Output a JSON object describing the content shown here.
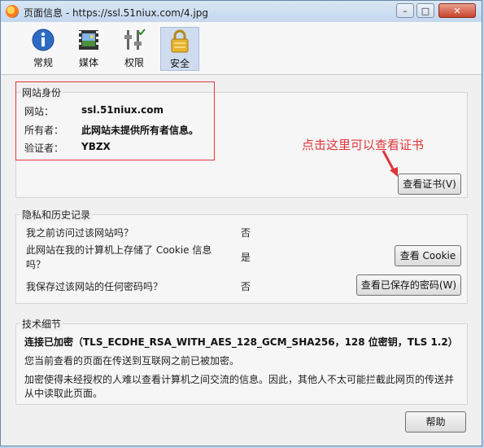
{
  "window": {
    "title": "页面信息 - https://ssl.51niux.com/4.jpg",
    "min": "–",
    "max": "□",
    "close": "✕"
  },
  "toolbar": {
    "items": [
      {
        "label": "常规",
        "icon": "info-icon"
      },
      {
        "label": "媒体",
        "icon": "media-icon"
      },
      {
        "label": "权限",
        "icon": "permissions-icon"
      },
      {
        "label": "安全",
        "icon": "lock-icon",
        "active": true
      }
    ]
  },
  "identity": {
    "legend": "网站身份",
    "website_label": "网站：",
    "website_value": "ssl.51niux.com",
    "owner_label": "所有者：",
    "owner_value": "此网站未提供所有者信息。",
    "verifier_label": "验证者：",
    "verifier_value": "YBZX",
    "view_cert_button": "查看证书(V)"
  },
  "annotation": {
    "text": "点击这里可以查看证书",
    "color": "#e0363a"
  },
  "privacy": {
    "legend": "隐私和历史记录",
    "q1": "我之前访问过该网站吗？",
    "a1": "否",
    "q2_line1": "此网站在我的计算机上存储了 Cookie 信息",
    "q2_line2": "吗？",
    "a2": "是",
    "view_cookie_button": "查看 Cookie",
    "q3": "我保存过该网站的任何密码吗？",
    "a3": "否",
    "view_passwords_button": "查看已保存的密码(W)"
  },
  "technical": {
    "legend": "技术细节",
    "line1": "连接已加密（TLS_ECDHE_RSA_WITH_AES_128_GCM_SHA256，128 位密钥，TLS 1.2）",
    "line2": "您当前查看的页面在传送到互联网之前已被加密。",
    "line3": "加密使得未经授权的人难以查看计算机之间交流的信息。因此，其他人不太可能拦截此网页的传送并",
    "line4": "从中读取此页面。"
  },
  "footer": {
    "help_button": "帮助"
  }
}
